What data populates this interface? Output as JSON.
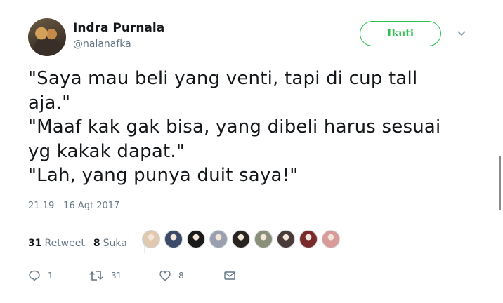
{
  "user": {
    "name": "Indra Purnala",
    "handle": "@nalanafka"
  },
  "follow_label": "Ikuti",
  "tweet_lines": [
    "\"Saya mau beli yang venti, tapi di cup tall",
    "aja.\"",
    "\"Maaf kak gak bisa, yang dibeli harus sesuai",
    "yg kakak dapat.\"",
    "\"Lah, yang punya duit saya!\""
  ],
  "timestamp": "21.19 - 16 Agt 2017",
  "stats": {
    "retweet_count": "31",
    "retweet_label": "Retweet",
    "like_count": "8",
    "like_label": "Suka"
  },
  "likers": [
    {
      "color": "#e0c9b0"
    },
    {
      "color": "#3b4a66"
    },
    {
      "color": "#1a1a1a"
    },
    {
      "color": "#9aa0b0"
    },
    {
      "color": "#2a2420"
    },
    {
      "color": "#8a8f7a"
    },
    {
      "color": "#4a3a3a"
    },
    {
      "color": "#7a2a2a"
    },
    {
      "color": "#d99a9a"
    }
  ],
  "actions": {
    "reply_count": "1",
    "retweet_count": "31",
    "like_count": "8"
  },
  "colors": {
    "follow_green": "#2fbf4e",
    "secondary_text": "#657786"
  }
}
